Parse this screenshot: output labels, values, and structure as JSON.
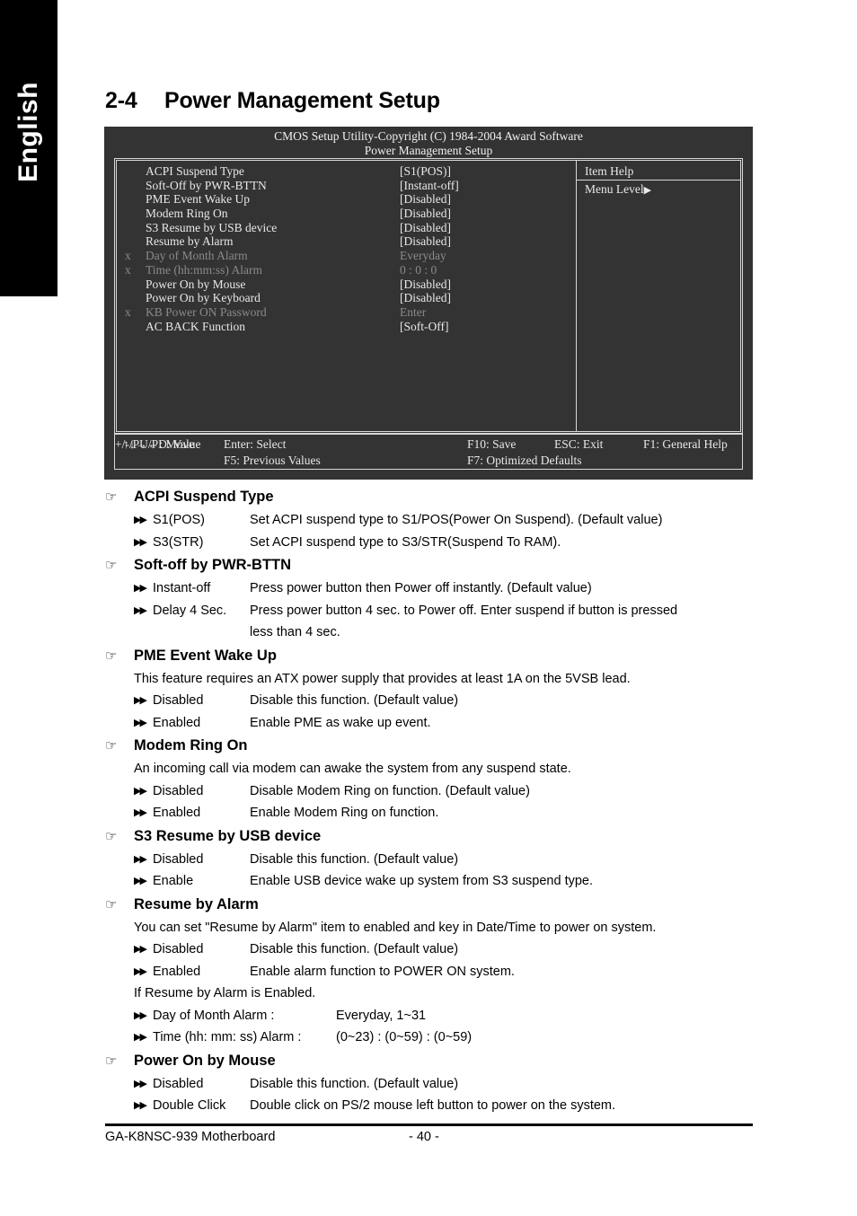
{
  "language_tab": "English",
  "heading": {
    "number": "2-4",
    "title": "Power Management Setup"
  },
  "bios": {
    "title_line1": "CMOS Setup Utility-Copyright (C) 1984-2004 Award Software",
    "title_line2": "Power Management Setup",
    "rows": [
      {
        "x": "",
        "label": "ACPI Suspend Type",
        "value": "[S1(POS)]",
        "dim": false
      },
      {
        "x": "",
        "label": "Soft-Off by PWR-BTTN",
        "value": "[Instant-off]",
        "dim": false
      },
      {
        "x": "",
        "label": "PME Event Wake Up",
        "value": "[Disabled]",
        "dim": false
      },
      {
        "x": "",
        "label": "Modem Ring On",
        "value": "[Disabled]",
        "dim": false
      },
      {
        "x": "",
        "label": "S3 Resume by USB device",
        "value": "[Disabled]",
        "dim": false
      },
      {
        "x": "",
        "label": "Resume by Alarm",
        "value": "[Disabled]",
        "dim": false
      },
      {
        "x": "x",
        "label": "Day of Month Alarm",
        "value": "Everyday",
        "dim": true
      },
      {
        "x": "x",
        "label": "Time (hh:mm:ss) Alarm",
        "value": "0 : 0 : 0",
        "dim": true
      },
      {
        "x": "",
        "label": "Power On by Mouse",
        "value": "[Disabled]",
        "dim": false
      },
      {
        "x": "",
        "label": "Power On by Keyboard",
        "value": "[Disabled]",
        "dim": false
      },
      {
        "x": "x",
        "label": "KB Power ON Password",
        "value": "Enter",
        "dim": true
      },
      {
        "x": "",
        "label": "AC BACK Function",
        "value": "[Soft-Off]",
        "dim": false
      }
    ],
    "help_title": "Item Help",
    "menu_level": "Menu Level",
    "menu_level_arrow": "▶",
    "footer": {
      "move": "↑↓→←: Move",
      "enter": "Enter: Select",
      "value": "+/-/PU/PD: Value",
      "f10": "F10: Save",
      "esc": "ESC: Exit",
      "f1": "F1: General Help",
      "f5": "F5: Previous Values",
      "f7": "F7: Optimized Defaults"
    }
  },
  "icons": {
    "hand": "☞",
    "bullet": "▶▶"
  },
  "sections": [
    {
      "title": "ACPI Suspend Type",
      "options": [
        {
          "name": "S1(POS)",
          "desc": "Set ACPI suspend type to S1/POS(Power On Suspend). (Default value)"
        },
        {
          "name": "S3(STR)",
          "desc": "Set ACPI suspend type to S3/STR(Suspend To RAM)."
        }
      ]
    },
    {
      "title": "Soft-off by PWR-BTTN",
      "options": [
        {
          "name": "Instant-off",
          "desc": "Press power button then Power off instantly. (Default value)"
        },
        {
          "name": "Delay 4 Sec.",
          "desc": "Press power button 4 sec. to Power off. Enter suspend if button is pressed",
          "cont": "less than 4 sec."
        }
      ]
    },
    {
      "title": "PME Event Wake Up",
      "note": "This feature requires an ATX power supply that provides at least 1A on the 5VSB lead.",
      "options": [
        {
          "name": "Disabled",
          "desc": "Disable this function. (Default value)"
        },
        {
          "name": "Enabled",
          "desc": "Enable PME as wake up event."
        }
      ]
    },
    {
      "title": "Modem Ring On",
      "note": "An incoming call via modem can awake the system from any suspend state.",
      "options": [
        {
          "name": "Disabled",
          "desc": "Disable Modem Ring on function. (Default value)"
        },
        {
          "name": "Enabled",
          "desc": "Enable Modem Ring on function."
        }
      ]
    },
    {
      "title": "S3 Resume by USB device",
      "options": [
        {
          "name": "Disabled",
          "desc": "Disable this function. (Default value)"
        },
        {
          "name": "Enable",
          "desc": "Enable USB device wake up system from S3 suspend type."
        }
      ]
    },
    {
      "title": "Resume by Alarm",
      "note": "You can set \"Resume by Alarm\" item to enabled and key in Date/Time to power on system.",
      "options": [
        {
          "name": "Disabled",
          "desc": "Disable this function. (Default value)"
        },
        {
          "name": "Enabled",
          "desc": "Enable alarm function to POWER ON system."
        }
      ],
      "note2": "If Resume by Alarm is Enabled.",
      "options2": [
        {
          "name": "Day of Month Alarm :",
          "desc": "Everyday, 1~31",
          "wide": true
        },
        {
          "name": "Time (hh: mm: ss) Alarm :",
          "desc": "(0~23) : (0~59) : (0~59)",
          "wide": true
        }
      ]
    },
    {
      "title": "Power On by Mouse",
      "options": [
        {
          "name": "Disabled",
          "desc": "Disable this function. (Default value)"
        },
        {
          "name": "Double Click",
          "desc": "Double click on PS/2 mouse left button to power on the system."
        }
      ]
    }
  ],
  "page_footer": {
    "left": "GA-K8NSC-939 Motherboard",
    "page": "- 40 -"
  }
}
